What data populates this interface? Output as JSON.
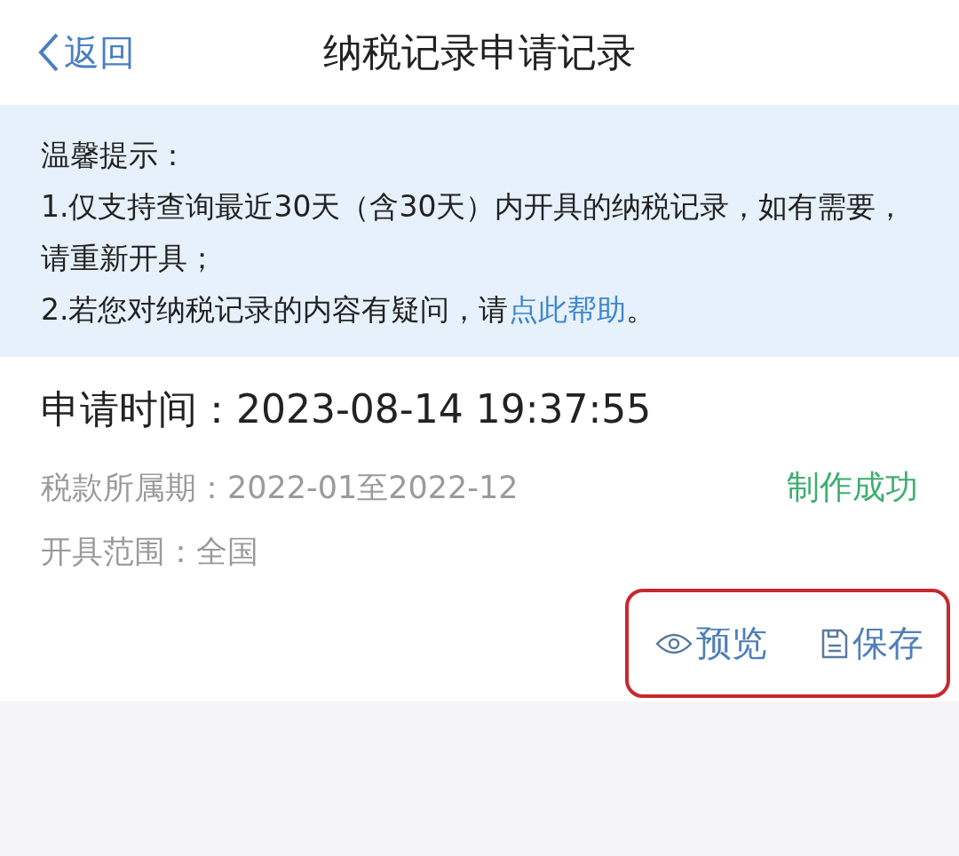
{
  "nav": {
    "back": "返回",
    "title": "纳税记录申请记录"
  },
  "notice": {
    "heading": "温馨提示：",
    "lines": [
      {
        "text": "1.仅支持查询最近30天（含30天）内开具的纳税记录，如有需要，请重新开具；"
      },
      {
        "text": "2.若您对纳税记录的内容有疑问，请",
        "link": "点此帮助",
        "suffix": "。"
      }
    ]
  },
  "record": {
    "time": "申请时间：2023-08-14 19:37:55",
    "period": "税款所属期：2022-01至2022-12",
    "status": "制作成功",
    "scope": "开具范围：全国",
    "actions_highlighted": true,
    "actions": [
      {
        "kind": "preview",
        "label": "预览"
      },
      {
        "kind": "save",
        "label": "保存"
      }
    ]
  }
}
